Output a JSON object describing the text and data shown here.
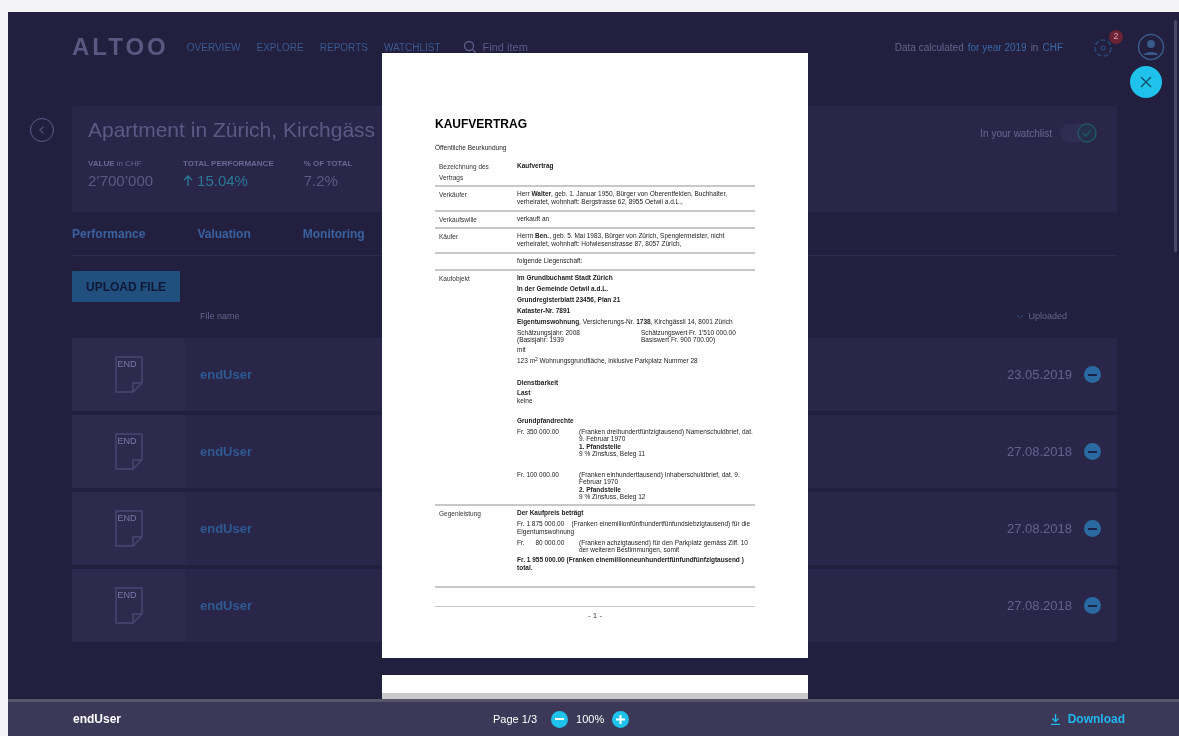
{
  "header": {
    "logo": "ALTOO",
    "nav": [
      {
        "label": "OVERVIEW"
      },
      {
        "label": "EXPLORE"
      },
      {
        "label": "REPORTS"
      },
      {
        "label": "WATCHLIST"
      }
    ],
    "search": {
      "placeholder": "Find item"
    },
    "data_note": [
      {
        "text": "Data calculated",
        "highlight": false
      },
      {
        "text": "for year 2019",
        "highlight": true
      },
      {
        "text": "in",
        "highlight": false
      },
      {
        "text": "CHF",
        "highlight": true
      }
    ],
    "notification_count": "2"
  },
  "asset": {
    "title": "Apartment in Zürich, Kirchgäss",
    "watchlist_label": "In your watchlist",
    "watchlist_on": true,
    "stats": [
      {
        "label": "VALUE",
        "unit": "in CHF",
        "value": "2’700’000"
      },
      {
        "label": "TOTAL PERFORMANCE",
        "value": "15.04%",
        "rising": true
      },
      {
        "label": "% OF TOTAL",
        "value": "7.2%"
      }
    ]
  },
  "tabs": [
    {
      "label": "Performance"
    },
    {
      "label": "Valuation"
    },
    {
      "label": "Monitoring"
    }
  ],
  "upload_button": "UPLOAD FILE",
  "columns": [
    {
      "label": "File name",
      "sorted": false
    },
    {
      "label": "Uploaded",
      "sorted": true
    }
  ],
  "files": [
    {
      "icon_label": "END",
      "name": "endUser",
      "uploaded": "23.05.2019"
    },
    {
      "icon_label": "END",
      "name": "endUser",
      "uploaded": "27.08.2018"
    },
    {
      "icon_label": "END",
      "name": "endUser",
      "uploaded": "27.08.2018"
    },
    {
      "icon_label": "END",
      "name": "endUser",
      "uploaded": "27.08.2018"
    }
  ],
  "document": {
    "title": "KAUFVERTRAG",
    "subtitle": "Öffentliche Beurkundung",
    "rows": [
      {
        "label": "Bezeichnung des Vertrags",
        "blocks": [
          {
            "kind": "text",
            "bold": true,
            "text": "Kaufvertrag"
          }
        ]
      },
      {
        "label": "Verkäufer",
        "blocks": [
          {
            "kind": "text",
            "bold": false,
            "text": "Herr **Walter**, geb. 1. Januar 1950, Bürger von Oberentfelden, Buchhalter, verheiratet, wohnhaft: Bergstrasse 62, 8955 Oetwil a.d.L.,"
          }
        ]
      },
      {
        "label": "Verkaufswille",
        "blocks": [
          {
            "kind": "text",
            "bold": false,
            "text": "verkauft an"
          }
        ]
      },
      {
        "label": "Käufer",
        "blocks": [
          {
            "kind": "text",
            "bold": false,
            "text": "Herrn **Ben.**, geb. 5. Mai 1983, Bürger von Zürich, Spenglermeister, nicht verheiratet, wohnhaft: Hofwiesenstrasse 87, 8057 Zürich,"
          }
        ]
      },
      {
        "blocks": [
          {
            "kind": "text",
            "bold": false,
            "text": "folgende Liegenschaft:"
          }
        ]
      },
      {
        "label": "Kaufobjekt",
        "blocks": [
          {
            "kind": "text",
            "bold": true,
            "text": "Im Grundbuchamt Stadt Zürich"
          },
          {
            "kind": "text",
            "bold": true,
            "text": "In der Gemeinde Oetwil a.d.L."
          },
          {
            "kind": "text",
            "bold": true,
            "text": "Grundregisterblatt 23456, Plan 21"
          },
          {
            "kind": "text",
            "bold": true,
            "text": "Kataster-Nr. 7891"
          },
          {
            "kind": "text",
            "bold": false,
            "text": "**Eigentumswohnung**, Versicherungs-Nr. **1738**, Kirchgässli 14, 8001 Zürich"
          },
          {
            "kind": "two_col",
            "left": "Schätzungsjahr: 2008\n(Basisjahr: 1939",
            "right": "Schätzungswert Fr. 1'510 000.00\nBasiswert Fr. 900 700.00)"
          },
          {
            "kind": "text",
            "bold": false,
            "text": "mit"
          },
          {
            "kind": "text",
            "bold": false,
            "text": "123 m$^{2}$ Wohnungsgrundfläche, inklusive Parkplatz Nummer 28"
          },
          {
            "kind": "gap"
          },
          {
            "kind": "text",
            "bold": true,
            "text": "Dienstbarkeit"
          },
          {
            "kind": "tight",
            "text": "**Last**\nkeine"
          },
          {
            "kind": "gap"
          },
          {
            "kind": "text",
            "bold": true,
            "text": "Grundpfandrechte"
          },
          {
            "kind": "amount",
            "amount": "Fr. 350 000.00",
            "text": "(Franken dreihundertfünfzigtausend) Namenschuldbrief, dat. 9. Februar 1970\n**1. Pfandstelle**\n9 % Zinsfuss, Beleg 11"
          },
          {
            "kind": "gap"
          },
          {
            "kind": "amount",
            "amount": "Fr. 100 000.00",
            "text": "(Franken einhunderttausend) Inhaberschuldbrief, dat. 9. Februar 1970\n**2. Pfandstelle**\n9 % Zinsfuss, Beleg 12"
          }
        ]
      },
      {
        "label": "Gegenleistung",
        "blocks": [
          {
            "kind": "text",
            "bold": true,
            "text": "Der Kaufpreis beträgt"
          },
          {
            "kind": "text",
            "bold": false,
            "text": "Fr. 1 875 000.00    (Franken einemillionfünfhundertfünfundsiebzigtausend) für die Eigentumswohnung"
          },
          {
            "kind": "amount",
            "amount": "Fr.      80 000.00",
            "text": "(Franken achzigtausend) für den Parkplatz gemäss Ziff. 10 der weiteren Bestimmungen, somit"
          },
          {
            "kind": "text",
            "bold": true,
            "text": "Fr. 1 955 000.00 (Franken einemillionneunhundertfünfundfünfzigtausend ) total."
          }
        ]
      }
    ],
    "page_number": "- 1 -"
  },
  "viewer_bar": {
    "file_name": "endUser",
    "page": "Page 1/3",
    "zoom": "100%",
    "download": "Download"
  }
}
